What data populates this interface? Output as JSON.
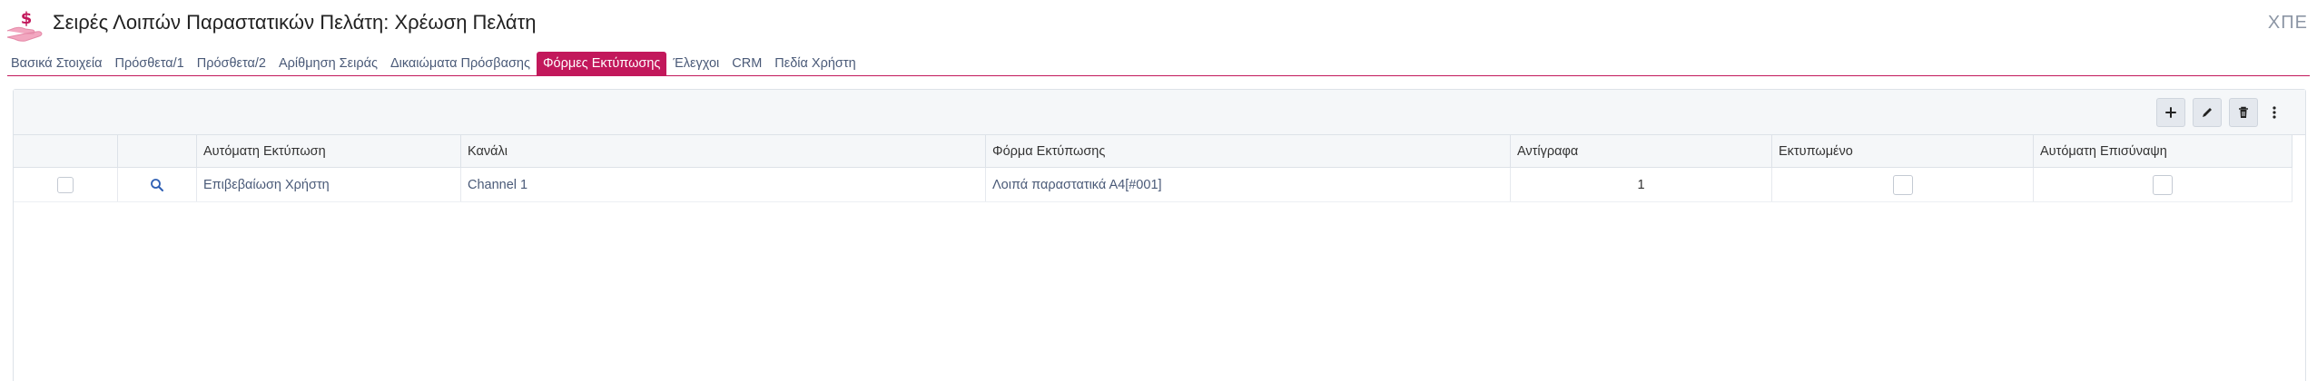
{
  "header": {
    "title": "Σειρές Λοιπών Παραστατικών Πελάτη: Χρέωση Πελάτη",
    "code": "ΧΠΕ",
    "icon": "money-hand-icon",
    "accent_color": "#c2185b"
  },
  "tabs": [
    {
      "label": "Βασικά Στοιχεία"
    },
    {
      "label": "Πρόσθετα/1"
    },
    {
      "label": "Πρόσθετα/2"
    },
    {
      "label": "Αρίθμηση Σειράς"
    },
    {
      "label": "Δικαιώματα Πρόσβασης"
    },
    {
      "label": "Φόρμες Εκτύπωσης",
      "active": true
    },
    {
      "label": "Έλεγχοι"
    },
    {
      "label": "CRM"
    },
    {
      "label": "Πεδία Χρήστη"
    }
  ],
  "toolbar": {
    "icons": [
      "plus-icon",
      "pencil-icon",
      "trash-icon",
      "more-vertical-icon"
    ]
  },
  "table": {
    "columns": [
      "Αυτόματη Εκτύπωση",
      "Κανάλι",
      "Φόρμα Εκτύπωσης",
      "Αντίγραφα",
      "Εκτυπωμένο",
      "Αυτόματη Επισύναψη"
    ],
    "rows": [
      {
        "auto_print": "Επιβεβαίωση Χρήστη",
        "channel": "Channel 1",
        "print_form": "Λοιπά παραστατικά Α4[#001]",
        "copies": "1",
        "printed": false,
        "auto_attach": false
      }
    ]
  }
}
